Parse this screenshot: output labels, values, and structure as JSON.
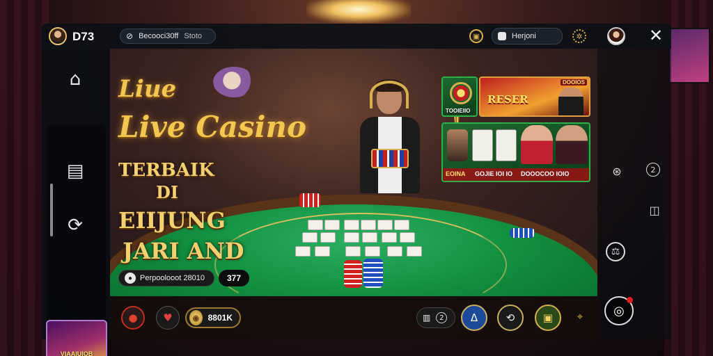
{
  "header": {
    "user_id": "D73",
    "search": {
      "label": "Becooci30ff",
      "extra": "Stoto"
    },
    "profile_name": "Herjoni"
  },
  "logo": {
    "line1": "Liue",
    "line2": "Live Casino"
  },
  "tagline": [
    "TERBAIK",
    "DI",
    "EIIJUNG",
    "JARI AND"
  ],
  "promos": {
    "top": {
      "tag": "DOOIOS",
      "title": "RESER",
      "label": "TOOIEIIO"
    },
    "bottom": {
      "strip_left": "EOINA",
      "strip_mid": "GOJIE IOI IO",
      "strip_right": "DOOOCOO IOIO"
    }
  },
  "bet": {
    "label": "Perpoolooot 28010",
    "amount": "377"
  },
  "bottom": {
    "coin_value": "8801K",
    "grid_count": "2"
  },
  "promo_thumb_label": "VIAAIUIOB",
  "icons": {
    "home": "home-icon",
    "history": "history-icon",
    "refresh": "refresh-icon",
    "close": "close-icon"
  },
  "colors": {
    "accent_gold": "#f3c650",
    "felt_green": "#129040",
    "frame_dark": "#0c1016"
  }
}
